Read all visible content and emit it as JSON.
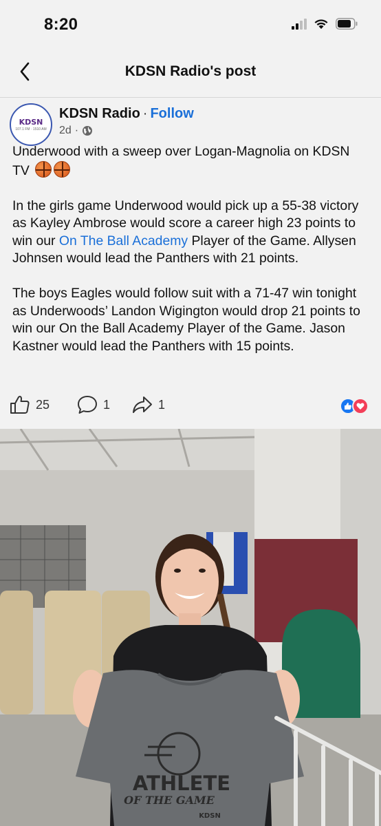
{
  "status_bar": {
    "time": "8:20"
  },
  "nav": {
    "title": "KDSN Radio's post"
  },
  "post": {
    "author": "KDSN Radio",
    "separator": "·",
    "follow_label": "Follow",
    "age": "2d",
    "meta_dot": "·",
    "avatar_text": "KDSN",
    "avatar_sub": "107.1 FM · 1510 AM",
    "line1": "Underwood with a sweep over Logan-Magnolia on KDSN TV",
    "para2_before_link": "In the girls game Underwood would pick up a 55-38 victory as Kayley Ambrose would score a career high 23 points to win our ",
    "para2_link": "On The Ball Academy",
    "para2_after_link": " Player of the Game. Allysen Johnsen would lead the Panthers with 21 points.",
    "para3": "The boys Eagles would follow suit with a 71-47 win tonight as Underwoods’ Landon Wigington would drop 21 points to win our On the Ball Academy Player of the Game. Jason Kastner would lead the Panthers with 15 points."
  },
  "actions": {
    "likes": "25",
    "comments": "1",
    "shares": "1"
  },
  "photo": {
    "shirt_line1": "ATHLETE",
    "shirt_line2": "OF THE GAME",
    "shirt_brand": "KDSN"
  },
  "colors": {
    "link": "#1a6fd8",
    "like_blue": "#1877f2",
    "love_red": "#f33e58"
  }
}
